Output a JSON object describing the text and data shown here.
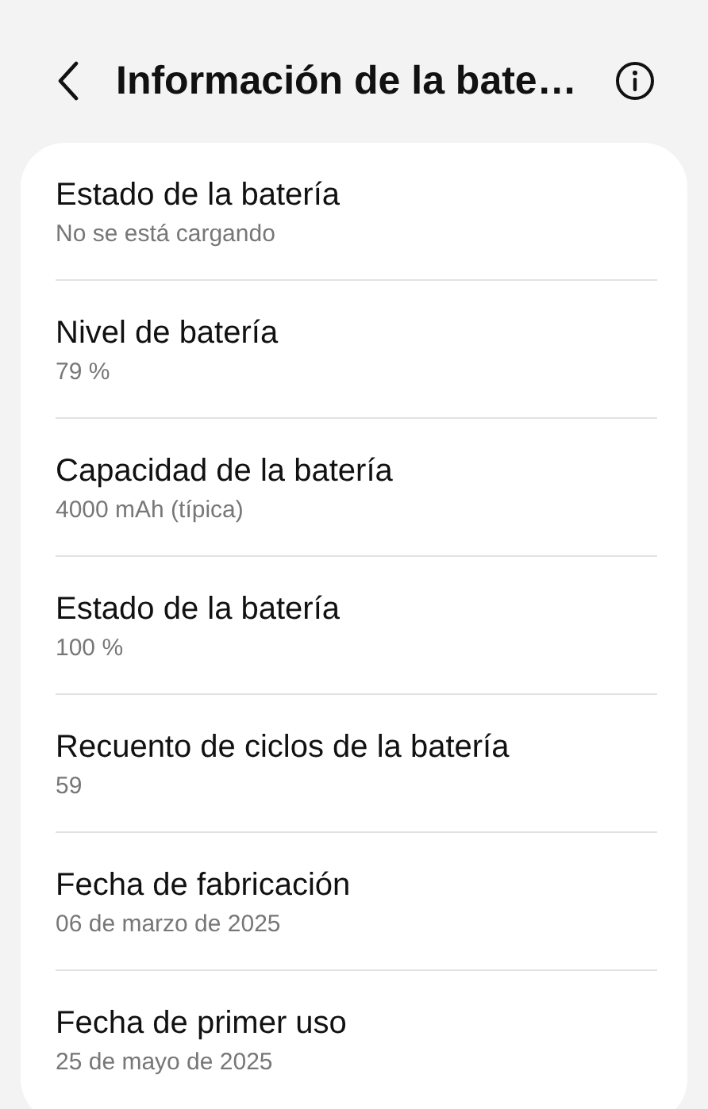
{
  "header": {
    "title": "Información de la bate…"
  },
  "items": [
    {
      "title": "Estado de la batería",
      "value": "No se está cargando"
    },
    {
      "title": "Nivel de batería",
      "value": "79 %"
    },
    {
      "title": "Capacidad de la batería",
      "value": "4000 mAh (típica)"
    },
    {
      "title": "Estado de la batería",
      "value": "100 %"
    },
    {
      "title": "Recuento de ciclos de la batería",
      "value": "59"
    },
    {
      "title": "Fecha de fabricación",
      "value": "06 de marzo de 2025"
    },
    {
      "title": "Fecha de primer uso",
      "value": "25 de mayo de 2025"
    }
  ]
}
